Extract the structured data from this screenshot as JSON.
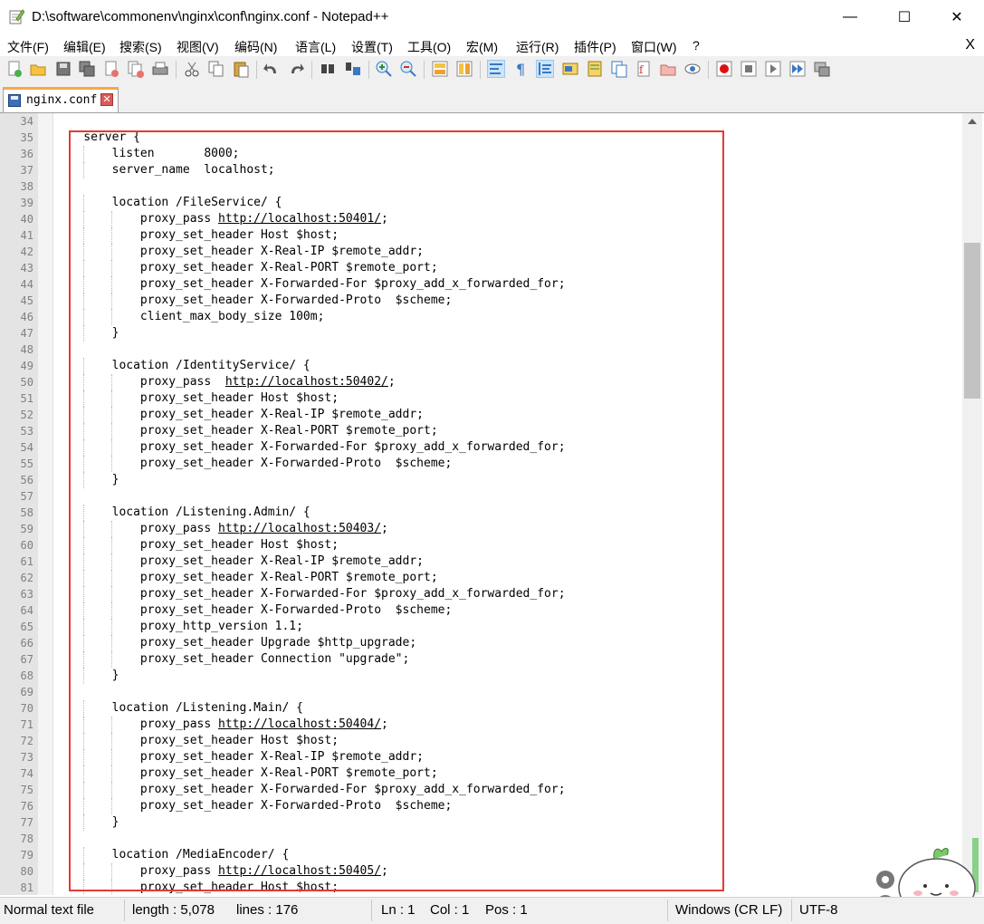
{
  "window": {
    "title": "D:\\software\\commonenv\\nginx\\conf\\nginx.conf - Notepad++",
    "minimize_glyph": "—",
    "maximize_glyph": "☐",
    "close_glyph": "✕"
  },
  "menu": {
    "items": [
      "文件(F)",
      "编辑(E)",
      "搜索(S)",
      "视图(V)",
      "编码(N)",
      "语言(L)",
      "设置(T)",
      "工具(O)",
      "宏(M)",
      "运行(R)",
      "插件(P)",
      "窗口(W)",
      "?"
    ],
    "close_glyph": "X"
  },
  "toolbar": {
    "icons": [
      "new-file-icon",
      "open-file-icon",
      "save-icon",
      "save-all-icon",
      "close-icon",
      "close-all-icon",
      "print-icon",
      "cut-icon",
      "copy-icon",
      "paste-icon",
      "undo-icon",
      "redo-icon",
      "find-icon",
      "replace-icon",
      "zoom-in-icon",
      "zoom-out-icon",
      "sync-vertical-icon",
      "sync-horizontal-icon",
      "word-wrap-icon",
      "show-all-chars-icon",
      "indent-guide-icon",
      "user-language-icon",
      "doc-map-icon",
      "function-list-icon",
      "folder-workspace-icon",
      "monitoring-icon",
      "eye-icon",
      "record-macro-icon",
      "stop-macro-icon",
      "play-macro-icon",
      "run-macro-multiple-icon",
      "save-macro-icon"
    ]
  },
  "tab": {
    "label": "nginx.conf",
    "close_glyph": "✕"
  },
  "editor": {
    "lines": [
      {
        "n": "34",
        "text": ""
      },
      {
        "n": "35",
        "text": "    server {"
      },
      {
        "n": "36",
        "text": "        listen       8000;"
      },
      {
        "n": "37",
        "text": "        server_name  localhost;"
      },
      {
        "n": "38",
        "text": ""
      },
      {
        "n": "39",
        "text": "        location /FileService/ {"
      },
      {
        "n": "40",
        "text": "            proxy_pass ",
        "url": "http://localhost:50401/",
        "after": ";"
      },
      {
        "n": "41",
        "text": "            proxy_set_header Host $host;"
      },
      {
        "n": "42",
        "text": "            proxy_set_header X-Real-IP $remote_addr;"
      },
      {
        "n": "43",
        "text": "            proxy_set_header X-Real-PORT $remote_port;"
      },
      {
        "n": "44",
        "text": "            proxy_set_header X-Forwarded-For $proxy_add_x_forwarded_for;"
      },
      {
        "n": "45",
        "text": "            proxy_set_header X-Forwarded-Proto  $scheme;"
      },
      {
        "n": "46",
        "text": "            client_max_body_size 100m;"
      },
      {
        "n": "47",
        "text": "        }"
      },
      {
        "n": "48",
        "text": ""
      },
      {
        "n": "49",
        "text": "        location /IdentityService/ {"
      },
      {
        "n": "50",
        "text": "            proxy_pass  ",
        "url": "http://localhost:50402/",
        "after": ";"
      },
      {
        "n": "51",
        "text": "            proxy_set_header Host $host;"
      },
      {
        "n": "52",
        "text": "            proxy_set_header X-Real-IP $remote_addr;"
      },
      {
        "n": "53",
        "text": "            proxy_set_header X-Real-PORT $remote_port;"
      },
      {
        "n": "54",
        "text": "            proxy_set_header X-Forwarded-For $proxy_add_x_forwarded_for;"
      },
      {
        "n": "55",
        "text": "            proxy_set_header X-Forwarded-Proto  $scheme;"
      },
      {
        "n": "56",
        "text": "        }"
      },
      {
        "n": "57",
        "text": ""
      },
      {
        "n": "58",
        "text": "        location /Listening.Admin/ {"
      },
      {
        "n": "59",
        "text": "            proxy_pass ",
        "url": "http://localhost:50403/",
        "after": ";"
      },
      {
        "n": "60",
        "text": "            proxy_set_header Host $host;"
      },
      {
        "n": "61",
        "text": "            proxy_set_header X-Real-IP $remote_addr;"
      },
      {
        "n": "62",
        "text": "            proxy_set_header X-Real-PORT $remote_port;"
      },
      {
        "n": "63",
        "text": "            proxy_set_header X-Forwarded-For $proxy_add_x_forwarded_for;"
      },
      {
        "n": "64",
        "text": "            proxy_set_header X-Forwarded-Proto  $scheme;"
      },
      {
        "n": "65",
        "text": "            proxy_http_version 1.1;"
      },
      {
        "n": "66",
        "text": "            proxy_set_header Upgrade $http_upgrade;"
      },
      {
        "n": "67",
        "text": "            proxy_set_header Connection \"upgrade\";"
      },
      {
        "n": "68",
        "text": "        }"
      },
      {
        "n": "69",
        "text": ""
      },
      {
        "n": "70",
        "text": "        location /Listening.Main/ {"
      },
      {
        "n": "71",
        "text": "            proxy_pass ",
        "url": "http://localhost:50404/",
        "after": ";"
      },
      {
        "n": "72",
        "text": "            proxy_set_header Host $host;"
      },
      {
        "n": "73",
        "text": "            proxy_set_header X-Real-IP $remote_addr;"
      },
      {
        "n": "74",
        "text": "            proxy_set_header X-Real-PORT $remote_port;"
      },
      {
        "n": "75",
        "text": "            proxy_set_header X-Forwarded-For $proxy_add_x_forwarded_for;"
      },
      {
        "n": "76",
        "text": "            proxy_set_header X-Forwarded-Proto  $scheme;"
      },
      {
        "n": "77",
        "text": "        }"
      },
      {
        "n": "78",
        "text": ""
      },
      {
        "n": "79",
        "text": "        location /MediaEncoder/ {"
      },
      {
        "n": "80",
        "text": "            proxy_pass ",
        "url": "http://localhost:50405/",
        "after": ";"
      },
      {
        "n": "81",
        "text": "            proxy_set_header Host $host;"
      }
    ]
  },
  "status": {
    "file_type": "Normal text file",
    "length": "length : 5,078",
    "lines": "lines : 176",
    "ln": "Ln : 1",
    "col": "Col : 1",
    "pos": "Pos : 1",
    "eol": "Windows (CR LF)",
    "encoding": "UTF-8"
  },
  "colors": {
    "highlight_box": "#e53935",
    "tab_accent": "#f7a74a"
  }
}
